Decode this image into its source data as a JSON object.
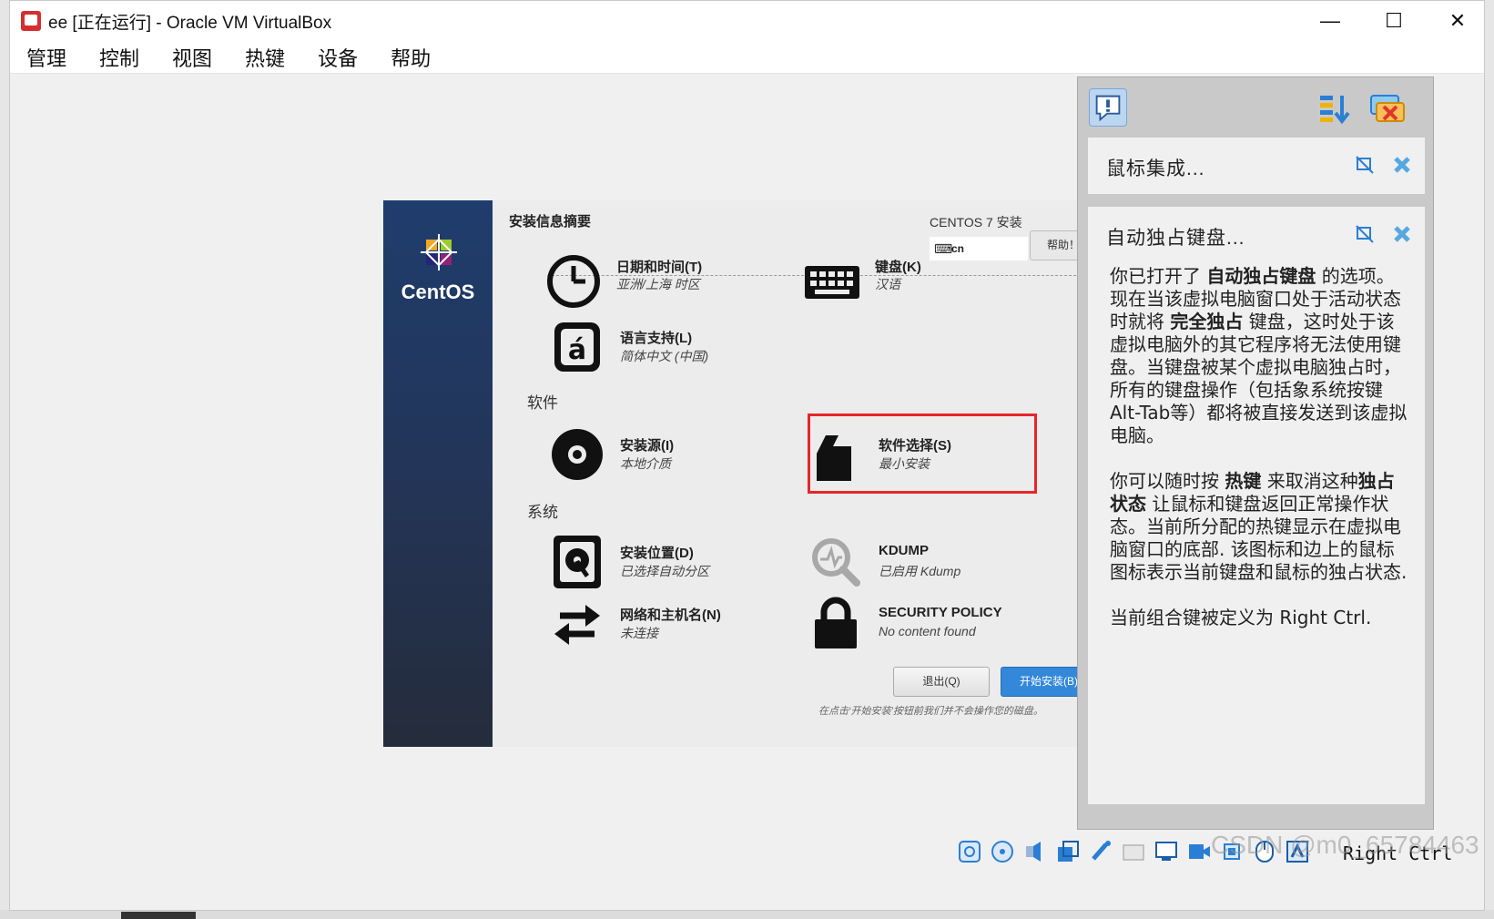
{
  "window": {
    "title": "ee [正在运行] - Oracle VM VirtualBox",
    "minimize": "—",
    "maximize": "☐",
    "close": "✕"
  },
  "menu": [
    "管理",
    "控制",
    "视图",
    "热键",
    "设备",
    "帮助"
  ],
  "installer": {
    "sidebar_brand": "CentOS",
    "header_title": "安装信息摘要",
    "header_right": "CENTOS 7 安装",
    "keyboard_layout": "cn",
    "help_button": "帮助！",
    "localization_spokes": [
      {
        "name": "日期和时间(T)",
        "status": "亚洲/上海 时区",
        "icon": "clock-icon"
      },
      {
        "name": "键盘(K)",
        "status": "汉语",
        "icon": "keyboard-icon"
      },
      {
        "name": "语言支持(L)",
        "status": "简体中文 (中国)",
        "icon": "language-icon"
      }
    ],
    "software_section": "软件",
    "software_spokes": [
      {
        "name": "安装源(I)",
        "status": "本地介质",
        "icon": "disc-icon"
      },
      {
        "name": "软件选择(S)",
        "status": "最小安装",
        "icon": "package-icon"
      }
    ],
    "system_section": "系统",
    "system_spokes": [
      {
        "name": "安装位置(D)",
        "status": "已选择自动分区",
        "icon": "harddrive-icon"
      },
      {
        "name": "KDUMP",
        "status": "已启用 Kdump",
        "icon": "search-icon"
      },
      {
        "name": "网络和主机名(N)",
        "status": "未连接",
        "icon": "network-arrows-icon"
      },
      {
        "name": "SECURITY POLICY",
        "status": "No content found",
        "icon": "lock-icon"
      }
    ],
    "quit_button": "退出(Q)",
    "begin_button": "开始安装(B)",
    "footer_note": "在点击‘开始安装’按钮前我们并不会操作您的磁盘。",
    "highlight_color": "#e6262a"
  },
  "notifications": {
    "card1_title": "鼠标集成...",
    "card2_title": "自动独占键盘...",
    "card2_body_p1_a": "你已打开了 ",
    "card2_body_p1_b": "自动独占键盘",
    "card2_body_p1_c": " 的选项。现在当该虚拟电脑窗口处于活动状态时就将 ",
    "card2_body_p1_d": "完全独占",
    "card2_body_p1_e": " 键盘，这时处于该虚拟电脑外的其它程序将无法使用键盘。当键盘被某个虚拟电脑独占时，所有的键盘操作（包括象系统按键Alt-Tab等）都将被直接发送到该虚拟电脑。",
    "card2_body_p2_a": "你可以随时按 ",
    "card2_body_p2_b": "热键",
    "card2_body_p2_c": " 来取消这种",
    "card2_body_p2_d": "独占状态",
    "card2_body_p2_e": " 让鼠标和键盘返回正常操作状态。当前所分配的热键显示在虚拟电脑窗口的底部. 该图标和边上的鼠标图标表示当前键盘和鼠标的独占状态.",
    "card2_body_p3": "当前组合键被定义为 Right Ctrl."
  },
  "statusbar": {
    "host_key": "Right Ctrl",
    "watermark": "CSDN @m0_65784463"
  }
}
